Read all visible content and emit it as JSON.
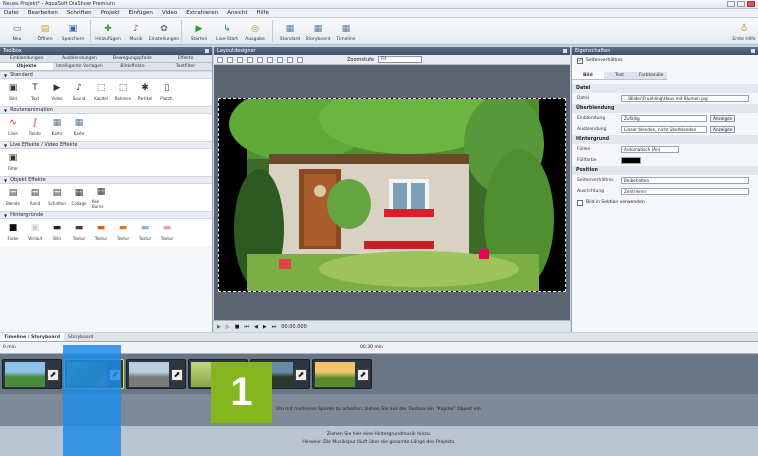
{
  "window": {
    "title": "Neues Projekt* - AquaSoft DiaShow Premium"
  },
  "menu": [
    "Datei",
    "Bearbeiten",
    "Schriften",
    "Projekt",
    "Einfügen",
    "Video",
    "Extrahieren",
    "Ansicht",
    "Hilfe"
  ],
  "toolbar": {
    "buttons": [
      {
        "label": "Neu",
        "icon": "new-file-icon",
        "glyph": "▭"
      },
      {
        "label": "Öffnen",
        "icon": "open-folder-icon",
        "glyph": "▤"
      },
      {
        "label": "Speichern",
        "icon": "save-icon",
        "glyph": "▣"
      },
      {
        "label": "Hinzufügen",
        "icon": "add-icon",
        "glyph": "✚"
      },
      {
        "label": "Musik",
        "icon": "music-icon",
        "glyph": "♪"
      },
      {
        "label": "Einstellungen",
        "icon": "gear-icon",
        "glyph": "✿"
      },
      {
        "label": "Starten",
        "icon": "play-icon",
        "glyph": "▶"
      },
      {
        "label": "Live-Start",
        "icon": "live-start-icon",
        "glyph": "↳"
      },
      {
        "label": "Ausgabe",
        "icon": "disc-icon",
        "glyph": "◎"
      },
      {
        "label": "Standard",
        "icon": "standard-layout-icon",
        "glyph": "▦"
      },
      {
        "label": "Storyboard",
        "icon": "storyboard-icon",
        "glyph": "▦"
      },
      {
        "label": "Timeline",
        "icon": "timeline-icon",
        "glyph": "▦"
      }
    ],
    "help": {
      "label": "Erste Hilfe",
      "icon": "lightbulb-icon",
      "glyph": "♁"
    }
  },
  "toolbox": {
    "title": "Toolbox",
    "tabs_top": [
      "Einblendungen",
      "Ausblendungen",
      "Bewegungspfade",
      "Effekte"
    ],
    "tabs_bottom": [
      "Objekte",
      "Intelligente Vorlagen",
      "Bildeffekte",
      "Textfilter"
    ],
    "sections": [
      {
        "title": "Standard",
        "items": [
          {
            "label": "Bild",
            "glyph": "▣"
          },
          {
            "label": "Text",
            "glyph": "T"
          },
          {
            "label": "Video",
            "glyph": "▶"
          },
          {
            "label": "Sound",
            "glyph": "♪"
          },
          {
            "label": "Kapitel",
            "glyph": "⬚"
          },
          {
            "label": "Rahmen",
            "glyph": "⬚"
          },
          {
            "label": "Partikel",
            "glyph": "✱"
          },
          {
            "label": "Platzh.",
            "glyph": "▯"
          }
        ]
      },
      {
        "title": "Routenanimation",
        "items": [
          {
            "label": "Linie",
            "glyph": "∿"
          },
          {
            "label": "Route",
            "glyph": "∫"
          },
          {
            "label": "Karte",
            "glyph": "▦"
          },
          {
            "label": "Karte",
            "glyph": "▦"
          }
        ]
      },
      {
        "title": "Live Effekte / Video Effekte",
        "items": [
          {
            "label": "Filter",
            "glyph": "▣"
          }
        ]
      },
      {
        "title": "Objekt Effekte",
        "items": [
          {
            "label": "Blende",
            "glyph": "▤"
          },
          {
            "label": "Rand",
            "glyph": "▤"
          },
          {
            "label": "Schatten",
            "glyph": "▤"
          },
          {
            "label": "Collage",
            "glyph": "▦"
          },
          {
            "label": "Ken Burns",
            "glyph": "▦"
          }
        ]
      },
      {
        "title": "Hintergründe",
        "items": [
          {
            "label": "Farbe",
            "glyph": "■"
          },
          {
            "label": "Verlauf",
            "glyph": "▣"
          },
          {
            "label": "Bild",
            "glyph": "▬"
          },
          {
            "label": "Textur",
            "glyph": "▬"
          },
          {
            "label": "Textur",
            "glyph": "▬"
          },
          {
            "label": "Textur",
            "glyph": "▬"
          },
          {
            "label": "Textur",
            "glyph": "▬"
          },
          {
            "label": "Textur",
            "glyph": "▬"
          }
        ]
      }
    ]
  },
  "preview": {
    "title": "Layoutdesigner",
    "zoom_label": "Zoomstufe",
    "zoom_value": "Fit",
    "timecode": "00:00.000"
  },
  "properties": {
    "title": "Eigenschaften",
    "keep_ratio": "Seitenverhältnis",
    "tabs": [
      "Bild",
      "Text",
      "Farbkanäle"
    ],
    "groups": [
      {
        "title": "Datei",
        "rows": [
          {
            "label": "Datei",
            "value": "...\\Bilder\\Fruehling\\Haus mit Blumen.jpg"
          }
        ]
      },
      {
        "title": "Überblendung",
        "rows": [
          {
            "label": "Einblendung",
            "value": "Zufällig",
            "button": "Anzeigen"
          },
          {
            "label": "Ausblendung",
            "value": "Linear blenden, nicht überblenden",
            "button": "Anzeigen"
          }
        ]
      },
      {
        "title": "Hintergrund",
        "rows": [
          {
            "label": "Füllen",
            "value": "Automatisch (An)"
          },
          {
            "label": "Füllfarbe",
            "value": ""
          }
        ]
      },
      {
        "title": "Position",
        "rows": [
          {
            "label": "Seitenverhältnis",
            "value": "Beibehalten"
          },
          {
            "label": "Ausrichtung",
            "value": "Zentrieren"
          }
        ]
      }
    ],
    "checkbox": "Bild in Sektion verwenden"
  },
  "timeline": {
    "tabs": [
      "Timeline / Storyboard",
      "Storyboard"
    ],
    "ruler_start": "0 min",
    "ruler_end": "00:30 min",
    "hint": "Um mit mehreren Spuren zu arbeiten, ziehen Sie aus der Toolbox ein \"Kapitel\" Objekt ein.",
    "bottom_hint_1": "Ziehen Sie hier eine Hintergrundmusik hinzu.",
    "bottom_hint_2": "Hinweis: Die Musikspur läuft über die gesamte Länge des Projekts."
  },
  "step_badge": "1",
  "colors": {
    "accent": "#2b84d8",
    "badge": "#85b61f",
    "panel_head": "#4a5b70"
  }
}
